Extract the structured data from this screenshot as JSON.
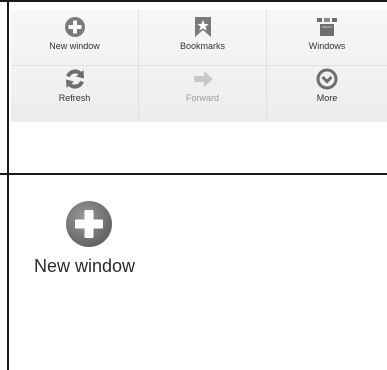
{
  "menu": {
    "items": [
      {
        "label": "New window",
        "icon": "plus-circle-icon",
        "enabled": true
      },
      {
        "label": "Bookmarks",
        "icon": "bookmark-icon",
        "enabled": true
      },
      {
        "label": "Windows",
        "icon": "windows-icon",
        "enabled": true
      },
      {
        "label": "Refresh",
        "icon": "refresh-icon",
        "enabled": true
      },
      {
        "label": "Forward",
        "icon": "forward-arrow-icon",
        "enabled": false
      },
      {
        "label": "More",
        "icon": "chevron-circle-icon",
        "enabled": true
      }
    ]
  },
  "detail": {
    "label": "New window",
    "icon": "plus-circle-icon"
  },
  "colors": {
    "icon_gray": "#7a7a7a",
    "icon_dark": "#5f5f5f",
    "disabled": "#c8c8c8",
    "rule": "#1a1a1a"
  }
}
